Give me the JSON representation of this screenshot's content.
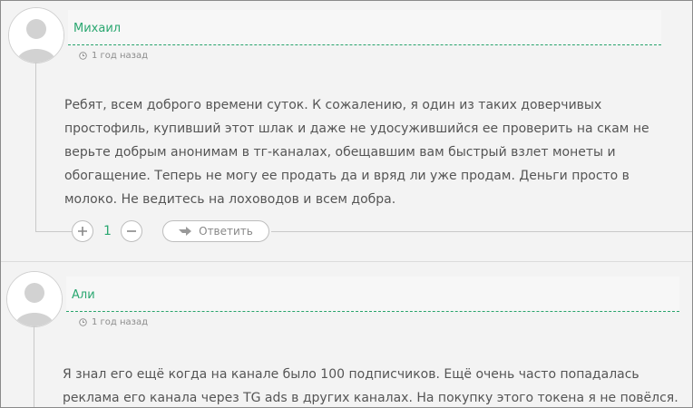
{
  "comments": [
    {
      "author": "Михаил",
      "date": "1 год назад",
      "text": "Ребят, всем доброго времени суток. К сожалению, я один из таких доверчивых простофиль, купивший этот шлак и даже не удосужившийся ее проверить на скам не верьте добрым анонимам в тг-каналах, обещавшим вам быстрый взлет монеты и обогащение. Теперь не могу ее продать да и вряд ли уже продам. Деньги просто в молоко. Не ведитесь на лоховодов и всем добра.",
      "votes": "1",
      "reply_label": "Ответить"
    },
    {
      "author": "Али",
      "date": "1 год назад",
      "text": "Я знал его ещё когда на канале было 100 подписчиков. Ещё очень часто попадалась реклама его канала через TG ads в других каналах. На покупку этого токена я не повёлся."
    }
  ],
  "icons": {
    "upvote": "plus-icon",
    "downvote": "minus-icon",
    "reply": "reply-arrow-icon",
    "date": "clock-icon"
  },
  "colors": {
    "accent": "#2aa770",
    "text": "#555555",
    "meta": "#8c8c8c"
  }
}
